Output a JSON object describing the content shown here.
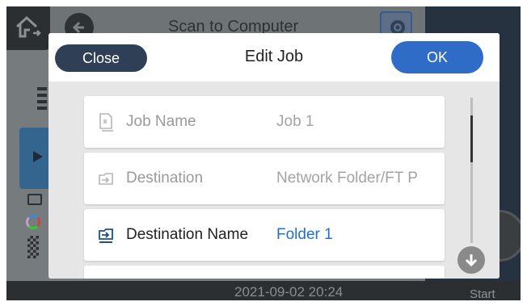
{
  "background_screen": {
    "title": "Scan to Computer",
    "datetime": "2021-09-02 20:24",
    "start_label": "Start"
  },
  "dialog": {
    "title": "Edit Job",
    "close_label": "Close",
    "ok_label": "OK",
    "rows": [
      {
        "label": "Job Name",
        "value": "Job 1",
        "icon": "job-name-icon",
        "state": "disabled"
      },
      {
        "label": "Destination",
        "value": "Network Folder/FT P",
        "icon": "destination-icon",
        "state": "disabled"
      },
      {
        "label": "Destination Name",
        "value": "Folder 1",
        "icon": "destination-name-icon",
        "state": "enabled"
      }
    ]
  },
  "colors": {
    "ok_button": "#2e6cc7",
    "close_button": "#2f3f55",
    "active_value": "#1d6fd8"
  }
}
